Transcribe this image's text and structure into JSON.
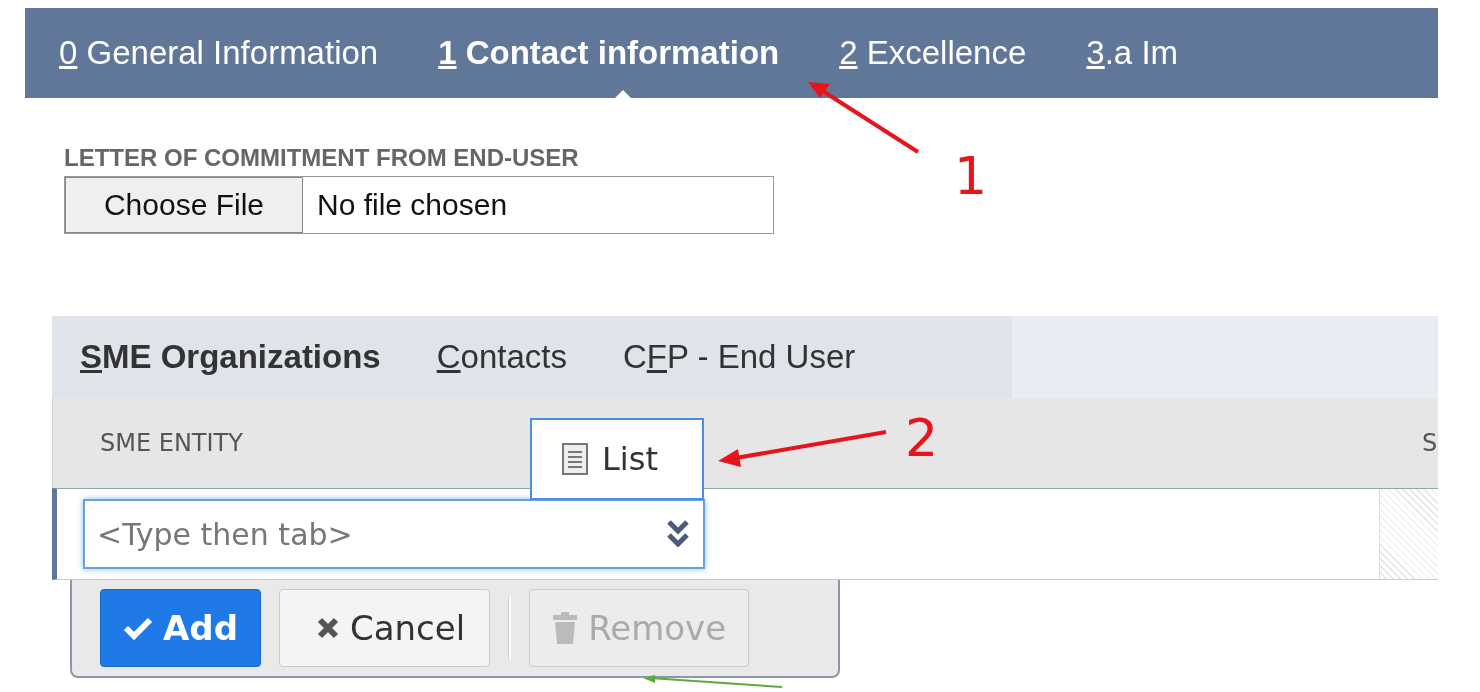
{
  "tabs": [
    {
      "key": "0",
      "rest": " General Information",
      "selected": false
    },
    {
      "key": "1",
      "rest": " Contact information",
      "selected": true
    },
    {
      "key": "2",
      "rest": " Excellence",
      "selected": false
    },
    {
      "key": "3",
      "rest": ".a Im",
      "selected": false
    }
  ],
  "file_field": {
    "label": "LETTER OF COMMITMENT FROM END-USER",
    "button": "Choose File",
    "status": "No file chosen"
  },
  "subtabs": [
    {
      "key": "S",
      "rest": "ME Organizations",
      "selected": true
    },
    {
      "key": "C",
      "rest": "ontacts",
      "selected": false
    },
    {
      "prefix": "C",
      "key": "F",
      "rest": "P - End User",
      "selected": false
    }
  ],
  "table": {
    "columns": [
      "SME ENTITY",
      "S"
    ],
    "row": {
      "placeholder": "<Type then tab>"
    }
  },
  "popup": {
    "label": "List"
  },
  "buttons": [
    {
      "label": "Add",
      "kind": "primary",
      "disabled": false
    },
    {
      "label": "Cancel",
      "kind": "cancel",
      "disabled": false
    },
    {
      "label": "Remove",
      "kind": "remove",
      "disabled": true
    }
  ],
  "annotations": [
    {
      "label": "1",
      "color": "#e8141b"
    },
    {
      "label": "2",
      "color": "#e8141b"
    },
    {
      "color": "#5aad3c"
    }
  ]
}
